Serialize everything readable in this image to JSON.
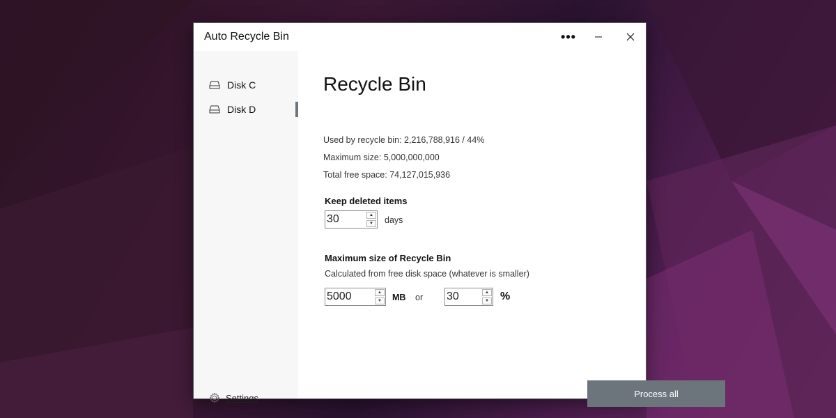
{
  "window": {
    "title": "Auto Recycle Bin",
    "more_label": "•••",
    "minimize_label": "—",
    "close_label": "✕"
  },
  "sidebar": {
    "items": [
      {
        "label": "Disk C",
        "icon": "drive-icon",
        "active": false
      },
      {
        "label": "Disk D",
        "icon": "drive-icon",
        "active": true
      }
    ],
    "settings_label": "Settings",
    "settings_icon": "gear-icon"
  },
  "main": {
    "heading": "Recycle Bin",
    "used_text": "Used by recycle bin: 2,216,788,916 / 44%",
    "max_size_text": "Maximum size: 5,000,000,000",
    "free_space_text": "Total free space: 74,127,015,936",
    "keep": {
      "title": "Keep deleted items",
      "value": "30",
      "unit": "days"
    },
    "max_size": {
      "title": "Maximum size of Recycle Bin",
      "subtitle": "Calculated from free disk space (whatever is smaller)",
      "mb_value": "5000",
      "mb_unit": "MB",
      "or_label": "or",
      "pct_value": "30",
      "pct_unit": "%"
    },
    "process_label": "Process all"
  },
  "colors": {
    "accent": "#6c757b",
    "sidebar_bg": "#f7f7f7"
  }
}
